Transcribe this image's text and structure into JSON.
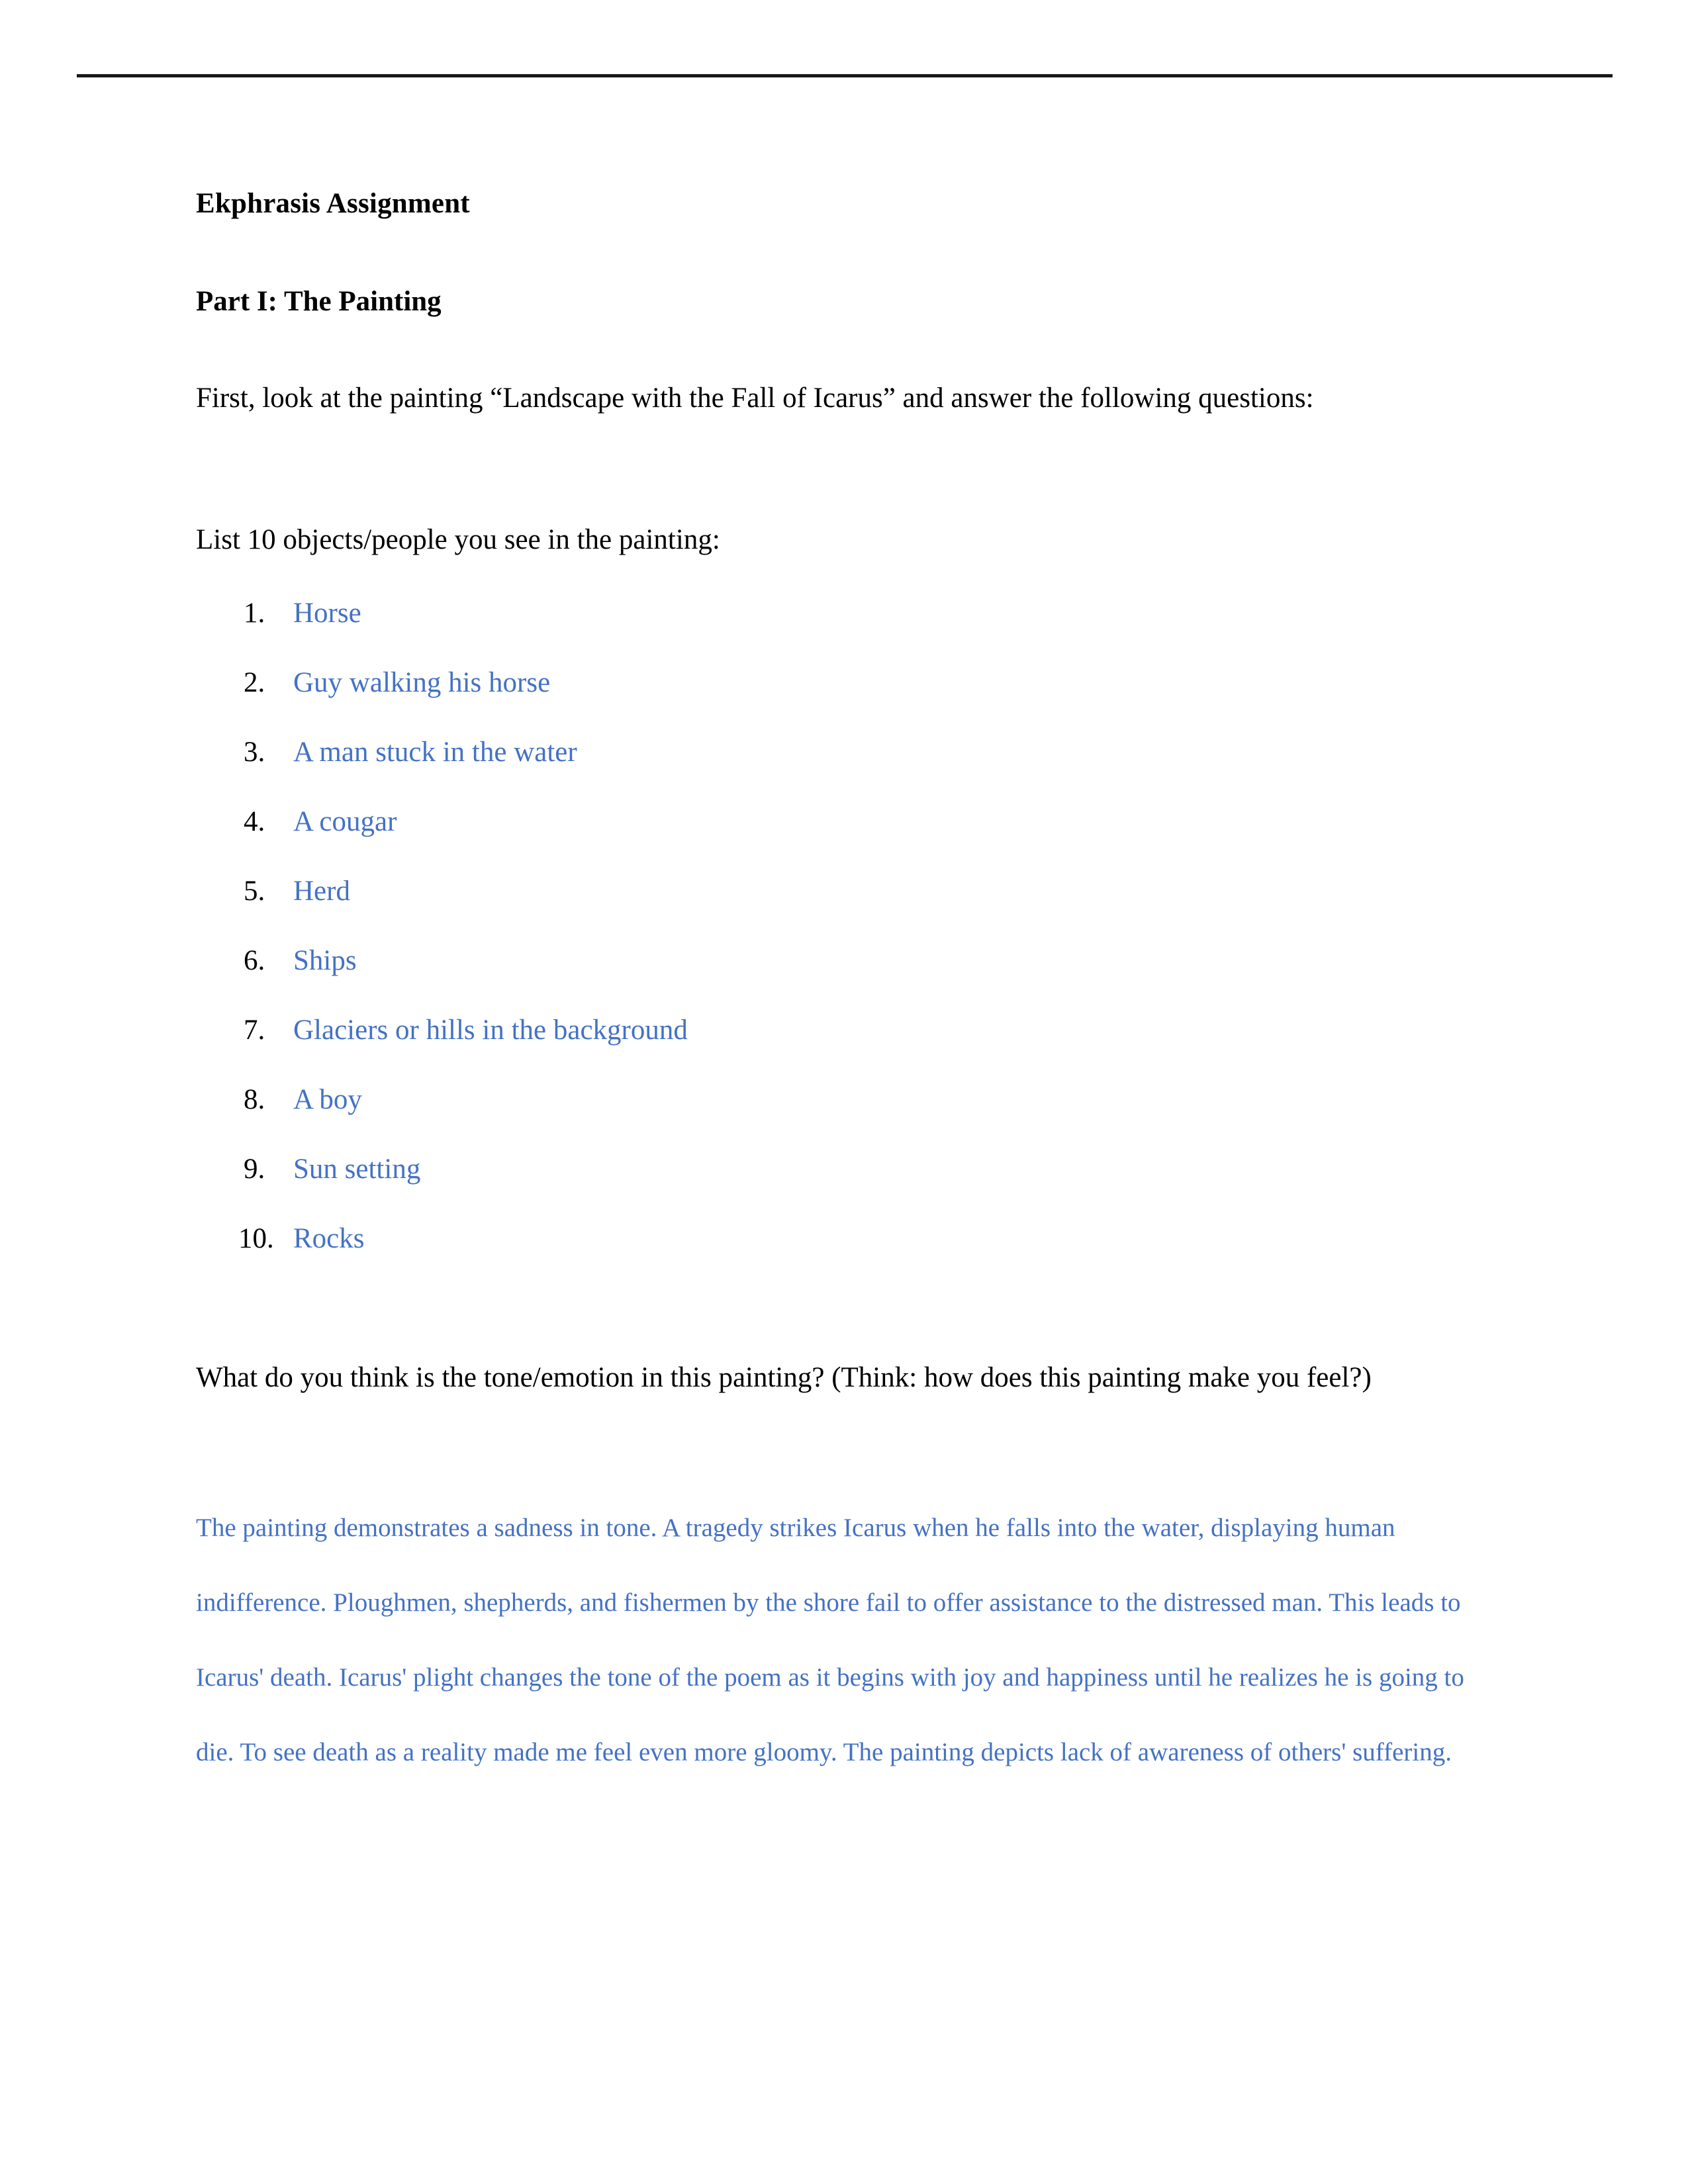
{
  "document": {
    "title": " Ekphrasis Assignment",
    "part_heading": "Part I: The Painting",
    "accent_color": "#4472C4",
    "text_color": "#000000",
    "rule_color": "#1a1a1a"
  },
  "prompts": {
    "intro_question": "First, look at the painting “Landscape with the Fall of Icarus” and answer the following questions:",
    "list_intro": "List 10 objects/people you see in the painting:",
    "tone_question": "What do you think is the tone/emotion in this painting? (Think: how does this painting make you feel?)"
  },
  "object_list": [
    {
      "marker": "1.",
      "label": "Horse"
    },
    {
      "marker": "2.",
      "label": "Guy walking his horse"
    },
    {
      "marker": "3.",
      "label": "A man stuck in the water"
    },
    {
      "marker": "4.",
      "label": "A cougar"
    },
    {
      "marker": "5.",
      "label": "Herd"
    },
    {
      "marker": "6.",
      "label": "Ships"
    },
    {
      "marker": "7.",
      "label": "Glaciers or hills in the background"
    },
    {
      "marker": "8.",
      "label": "A boy"
    },
    {
      "marker": "9.",
      "label": "Sun setting"
    },
    {
      "marker": "10.",
      "label": "Rocks"
    }
  ],
  "answers": {
    "tone_answer": "The painting demonstrates a sadness in tone. A tragedy strikes Icarus when he falls into the water, displaying human indifference. Ploughmen, shepherds, and fishermen by the shore fail to offer assistance to the distressed man. This leads to Icarus' death. Icarus' plight changes the tone of the poem as it begins with joy and happiness until he realizes he is going to die. To see death as a reality made me feel even more gloomy. The painting depicts lack of awareness of others' suffering."
  }
}
